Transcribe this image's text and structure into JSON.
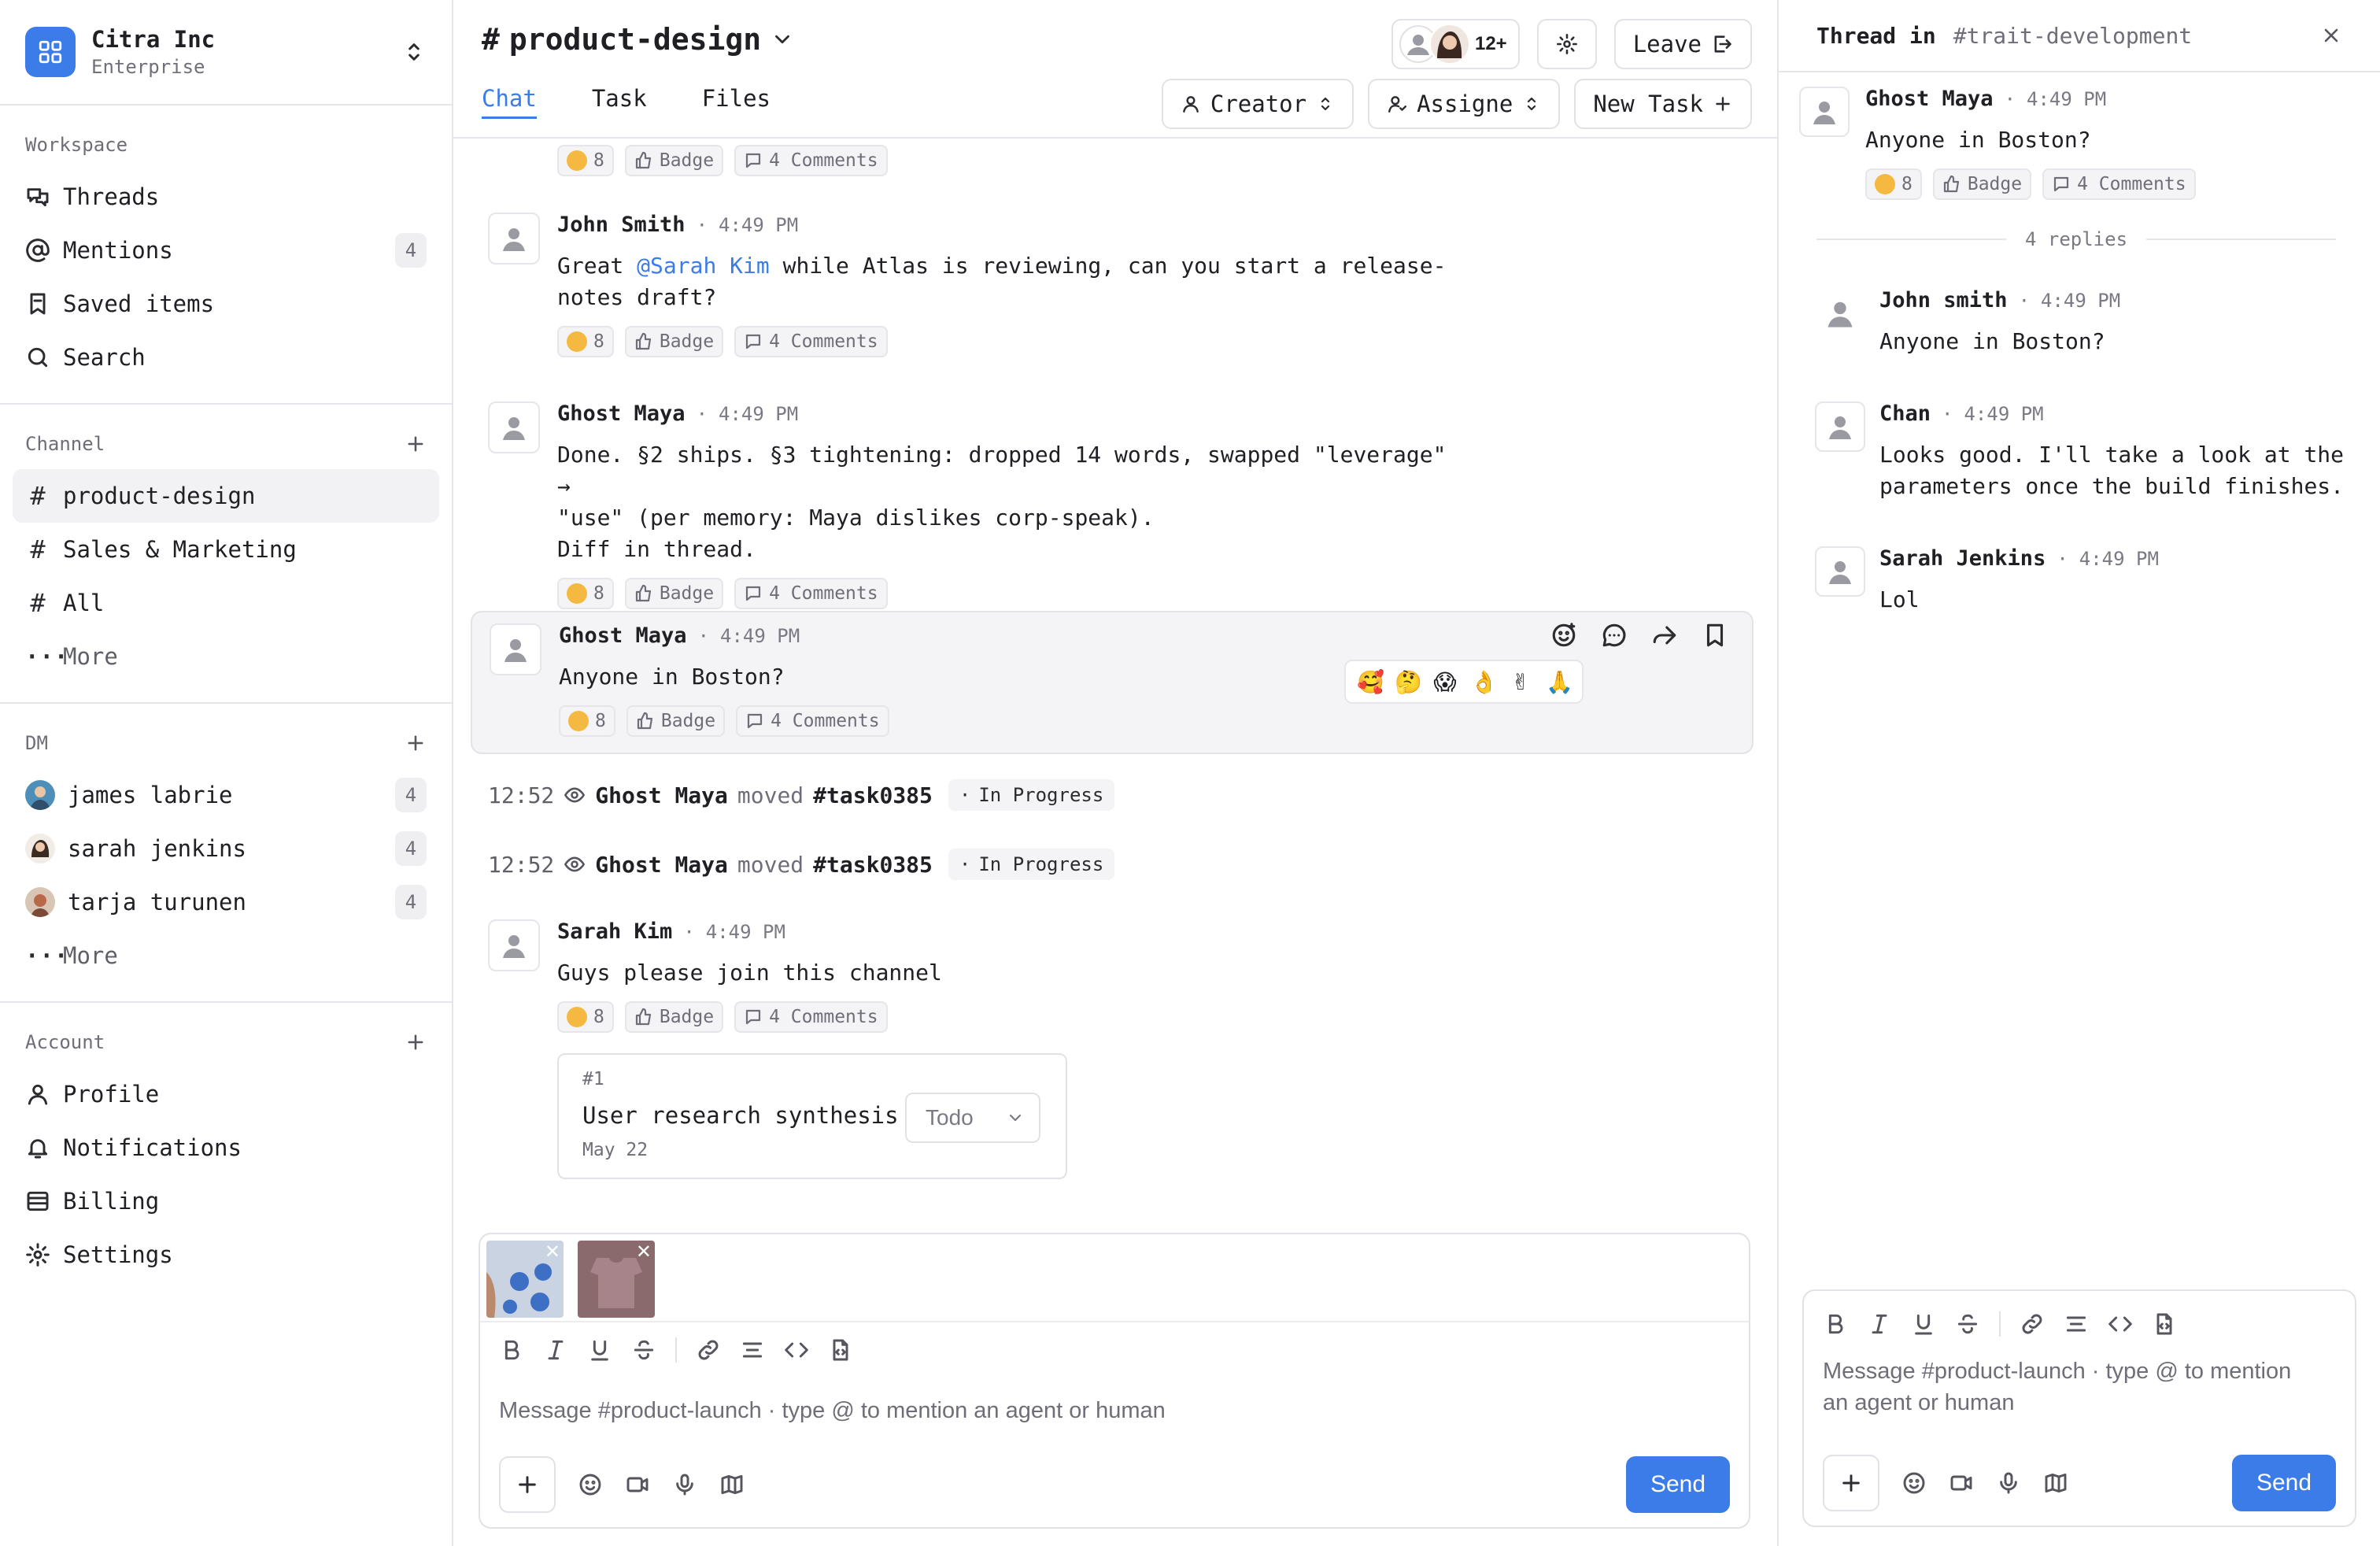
{
  "org": {
    "name": "Citra Inc",
    "plan": "Enterprise"
  },
  "sidebar": {
    "workspace_title": "Workspace",
    "workspace_items": [
      {
        "label": "Threads",
        "icon": "threads-icon"
      },
      {
        "label": "Mentions",
        "icon": "at-icon",
        "count": "4"
      },
      {
        "label": "Saved items",
        "icon": "bookmark-icon"
      },
      {
        "label": "Search",
        "icon": "search-icon"
      }
    ],
    "channel_title": "Channel",
    "channels": [
      {
        "label": "product-design",
        "active": true
      },
      {
        "label": "Sales & Marketing"
      },
      {
        "label": "All"
      }
    ],
    "channel_more": "More",
    "dm_title": "DM",
    "dms": [
      {
        "label": "james labrie",
        "count": "4"
      },
      {
        "label": "sarah jenkins",
        "count": "4"
      },
      {
        "label": "tarja turunen",
        "count": "4"
      }
    ],
    "dm_more": "More",
    "account_title": "Account",
    "account_items": [
      {
        "label": "Profile",
        "icon": "user-icon"
      },
      {
        "label": "Notifications",
        "icon": "bell-icon"
      },
      {
        "label": "Billing",
        "icon": "billing-icon"
      },
      {
        "label": "Settings",
        "icon": "gear-icon"
      }
    ]
  },
  "header": {
    "channel": "product-design",
    "member_count": "12+",
    "leave_label": "Leave",
    "tabs": [
      "Chat",
      "Task",
      "Files"
    ],
    "active_tab": "Chat",
    "filters": {
      "creator": "Creator",
      "assignee": "Assigne",
      "new_task": "New Task"
    }
  },
  "reactions": {
    "emoji_count": "8",
    "badge": "Badge",
    "comments": "4 Comments"
  },
  "messages": [
    {
      "author": "John Smith",
      "time": "4:49 PM",
      "pre": "Great ",
      "mention": "@Sarah Kim",
      "post": " while Atlas is reviewing, can you start a release-\nnotes draft?"
    },
    {
      "author": "Ghost Maya",
      "time": "4:49 PM",
      "text": "Done. §2 ships. §3 tightening: dropped 14 words, swapped \"leverage\" →\n\"use\" (per memory: Maya dislikes corp-speak).\nDiff in thread."
    },
    {
      "author": "Ghost Maya",
      "time": "4:49 PM",
      "text": "Anyone in Boston?"
    },
    {
      "author": "Sarah Kim",
      "time": "4:49 PM",
      "text": "Guys please join this channel"
    }
  ],
  "system_events": [
    {
      "time": "12:52",
      "who": "Ghost Maya",
      "verb": "moved",
      "task": "#task0385",
      "status": "In Progress"
    },
    {
      "time": "12:52",
      "who": "Ghost Maya",
      "verb": "moved",
      "task": "#task0385",
      "status": "In Progress"
    }
  ],
  "task_card": {
    "number": "#1",
    "title": "User research synthesis",
    "status": "Todo",
    "date": "May 22"
  },
  "composer": {
    "placeholder": "Message #product-launch · type @ to mention an agent or human",
    "send": "Send"
  },
  "thread": {
    "title": "Thread in",
    "channel": "#trait-development",
    "root": {
      "author": "Ghost Maya",
      "time": "4:49 PM",
      "text": "Anyone in Boston?"
    },
    "replies_label": "4 replies",
    "replies": [
      {
        "author": "John smith",
        "time": "4:49 PM",
        "text": "Anyone in Boston?"
      },
      {
        "author": "Chan",
        "time": "4:49 PM",
        "text": "Looks good. I'll take a look at the\nparameters once the build finishes."
      },
      {
        "author": "Sarah Jenkins",
        "time": "4:49 PM",
        "text": "Lol"
      }
    ],
    "composer_placeholder": "Message #product-launch · type @ to mention\nan agent or human",
    "send": "Send"
  },
  "colors": {
    "accent": "#3b7ce8",
    "border": "#e6e6ea",
    "muted": "#6e6e78"
  }
}
